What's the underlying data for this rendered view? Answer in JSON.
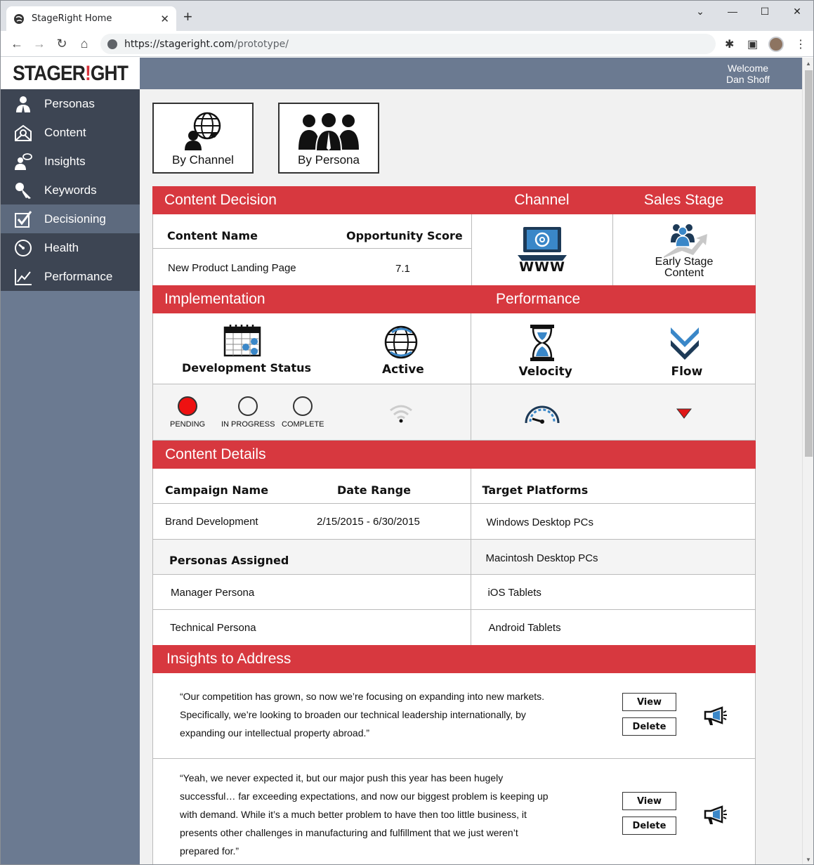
{
  "browser": {
    "tab_title": "StageRight Home",
    "url_host": "https://stageright.com",
    "url_path": "/prototype/"
  },
  "header": {
    "logo": "STAGERIGHT",
    "welcome_line1": "Welcome",
    "welcome_line2": "Dan Shoff"
  },
  "sidebar": {
    "items": [
      {
        "label": "Personas",
        "icon": "user-icon"
      },
      {
        "label": "Content",
        "icon": "envelope-icon"
      },
      {
        "label": "Insights",
        "icon": "speech-user-icon"
      },
      {
        "label": "Keywords",
        "icon": "key-icon"
      },
      {
        "label": "Decisioning",
        "icon": "checkbox-icon",
        "active": true
      },
      {
        "label": "Health",
        "icon": "gauge-icon"
      },
      {
        "label": "Performance",
        "icon": "chart-line-icon"
      }
    ]
  },
  "filters": {
    "by_channel": "By Channel",
    "by_persona": "By Persona"
  },
  "decision": {
    "heading": "Content Decision",
    "channel_heading": "Channel",
    "sales_stage_heading": "Sales Stage",
    "content_name_label": "Content Name",
    "opportunity_score_label": "Opportunity Score",
    "content_name": "New Product Landing Page",
    "opportunity_score": "7.1",
    "channel_value": "WWW",
    "sales_stage_line1": "Early Stage",
    "sales_stage_line2": "Content"
  },
  "implementation": {
    "heading": "Implementation",
    "performance_heading": "Performance",
    "development_status": "Development Status",
    "active": "Active",
    "velocity": "Velocity",
    "flow": "Flow",
    "statuses": [
      "PENDING",
      "IN PROGRESS",
      "COMPLETE"
    ],
    "status_colors": {
      "pending": "#ee1111",
      "inactive": "#f4f4f4"
    }
  },
  "details": {
    "heading": "Content Details",
    "campaign_name_label": "Campaign Name",
    "date_range_label": "Date Range",
    "target_platforms_label": "Target Platforms",
    "campaign_name": "Brand Development",
    "date_range": "2/15/2015 - 6/30/2015",
    "personas_label": "Personas Assigned",
    "personas": [
      "Manager Persona",
      "Technical Persona"
    ],
    "platforms": [
      "Windows Desktop PCs",
      "Macintosh Desktop PCs",
      "iOS Tablets",
      "Android Tablets"
    ]
  },
  "insights": {
    "heading": "Insights to Address",
    "view_label": "View",
    "delete_label": "Delete",
    "items": [
      {
        "text": "“Our competition has grown, so now we’re focusing on expanding into new markets. Specifically, we’re looking to broaden our technical leadership internationally, by expanding our intellectual property abroad.”"
      },
      {
        "text": "“Yeah, we never expected it, but our major push this year has been hugely successful… far exceeding expectations, and now our biggest problem is keeping up with demand. While it’s a much better problem to have then too little business, it presents other challenges in manufacturing and fulfillment that we just weren’t prepared for.”"
      }
    ]
  },
  "colors": {
    "brand_red": "#d7383f",
    "sidebar_dark": "#3d4553",
    "sidebar_slate": "#6b7a91",
    "sidebar_active": "#5d6a7e"
  }
}
